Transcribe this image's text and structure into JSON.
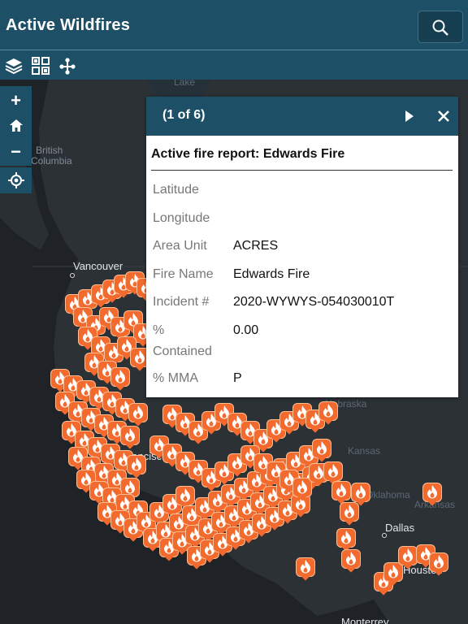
{
  "header": {
    "title": "Active Wildfires",
    "search_icon": "search-icon"
  },
  "toolbar": {
    "tools": [
      "layers-icon",
      "basemap-gallery-icon",
      "share-network-icon"
    ]
  },
  "map_controls": {
    "zoom_in": "+",
    "zoom_out": "−",
    "home_icon": "home-icon",
    "locate_icon": "locate-icon"
  },
  "map": {
    "places": [
      {
        "name": "British",
        "kind": "region"
      },
      {
        "name": "Columbia",
        "kind": "region"
      },
      {
        "name": "Vancouver",
        "kind": "city"
      },
      {
        "name": "Nebraska",
        "kind": "state"
      },
      {
        "name": "Kansas",
        "kind": "state"
      },
      {
        "name": "Oklahoma",
        "kind": "state"
      },
      {
        "name": "Arkansas",
        "kind": "state"
      },
      {
        "name": "Dallas",
        "kind": "city"
      },
      {
        "name": "Houston",
        "kind": "city"
      },
      {
        "name": "Monterrey",
        "kind": "city"
      },
      {
        "name": "Francisco",
        "kind": "city"
      },
      {
        "name": "Lake",
        "kind": "water"
      }
    ],
    "fire_marker_color": "#f26a2e"
  },
  "popup": {
    "pager": "(1 of 6)",
    "title": "Active fire report: Edwards Fire",
    "fields": [
      {
        "label": "Latitude",
        "value": ""
      },
      {
        "label": "Longitude",
        "value": ""
      },
      {
        "label": "Area Unit",
        "value": "ACRES"
      },
      {
        "label": "Fire Name",
        "value": "Edwards Fire"
      },
      {
        "label": "Incident #",
        "value": "2020-WYWYS-054030010T"
      },
      {
        "label": "% Contained",
        "value": "0.00"
      },
      {
        "label": "% MMA",
        "value": "P"
      }
    ]
  },
  "colors": {
    "header": "#1d4f66",
    "map_background": "#2a2e33",
    "accent_marker": "#f26a2e"
  }
}
